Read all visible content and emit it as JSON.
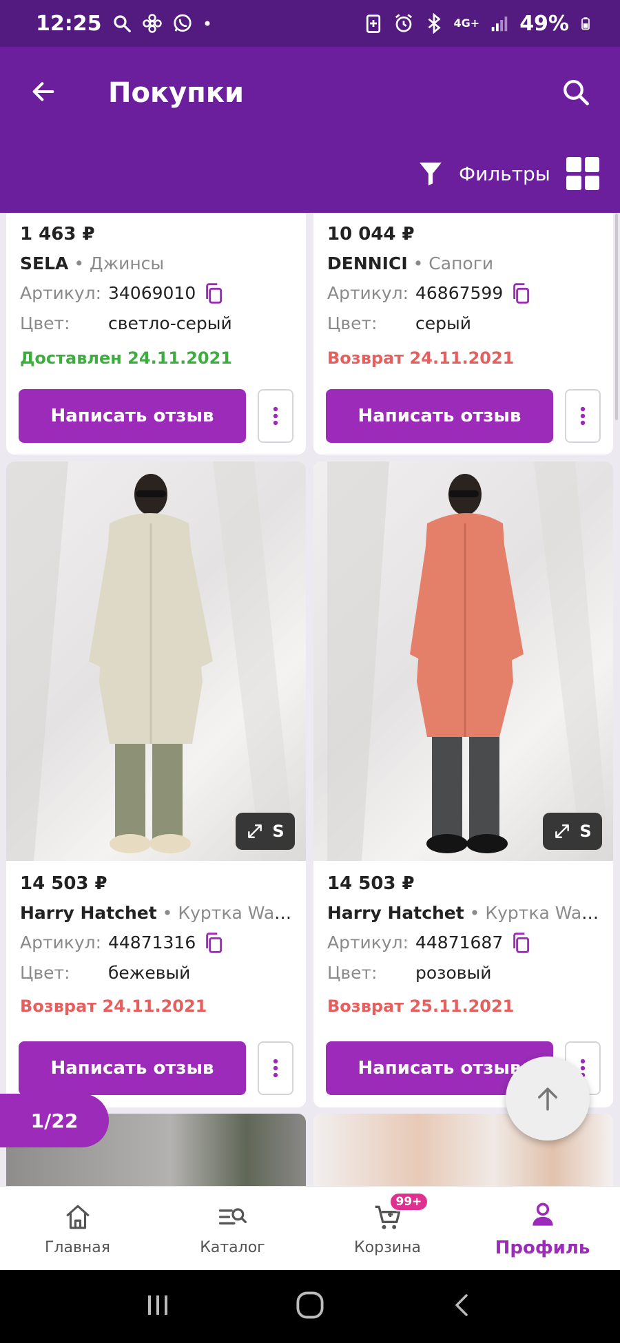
{
  "status_bar": {
    "time": "12:25",
    "battery": "49%",
    "network": "4G+"
  },
  "header": {
    "title": "Покупки",
    "filter_label": "Фильтры"
  },
  "products": [
    {
      "price": "1 463 ₽",
      "brand": "SELA",
      "category": "Джинсы",
      "article_label": "Артикул:",
      "article": "34069010",
      "color_label": "Цвет:",
      "color": "светло-серый",
      "status": "Доставлен 24.11.2021",
      "status_color": "#3cae3e",
      "review_label": "Написать отзыв"
    },
    {
      "price": "10 044 ₽",
      "brand": "DENNICI",
      "category": "Сапоги",
      "article_label": "Артикул:",
      "article": "46867599",
      "color_label": "Цвет:",
      "color": "серый",
      "status": "Возврат 24.11.2021",
      "status_color": "#e65f5f",
      "review_label": "Написать отзыв"
    },
    {
      "price": "14 503 ₽",
      "brand": "Harry Hatchet",
      "category": "Куртка Warme...",
      "article_label": "Артикул:",
      "article": "44871316",
      "color_label": "Цвет:",
      "color": "бежевый",
      "status": "Возврат 24.11.2021",
      "status_color": "#e65f5f",
      "review_label": "Написать отзыв",
      "size": "S",
      "coat_color": "#ddd9c6"
    },
    {
      "price": "14 503 ₽",
      "brand": "Harry Hatchet",
      "category": "Куртка Warme...",
      "article_label": "Артикул:",
      "article": "44871687",
      "color_label": "Цвет:",
      "color": "розовый",
      "status": "Возврат 25.11.2021",
      "status_color": "#e65f5f",
      "review_label": "Написать отзыв",
      "size": "S",
      "coat_color": "#e4806a"
    }
  ],
  "pagination": {
    "label": "1/22"
  },
  "bottom_nav": {
    "items": [
      {
        "label": "Главная",
        "icon": "home-icon"
      },
      {
        "label": "Каталог",
        "icon": "catalog-icon"
      },
      {
        "label": "Корзина",
        "icon": "cart-icon",
        "badge": "99+"
      },
      {
        "label": "Профиль",
        "icon": "profile-icon",
        "active": true
      }
    ]
  },
  "colors": {
    "brand_purple": "#6b1f9c",
    "button_purple": "#9b2bb8",
    "delivered_green": "#3cae3e",
    "return_red": "#e65f5f"
  }
}
